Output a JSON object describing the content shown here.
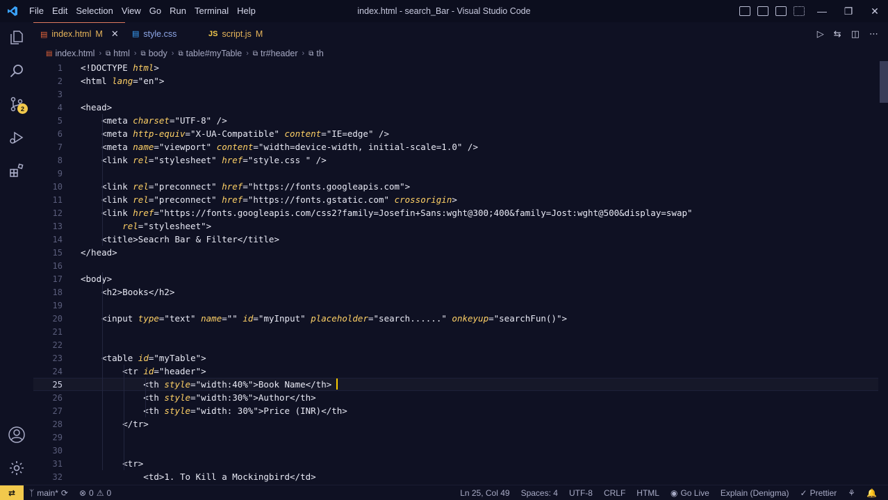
{
  "window": {
    "title": "index.html - search_Bar - Visual Studio Code",
    "menu": [
      "File",
      "Edit",
      "Selection",
      "View",
      "Go",
      "Run",
      "Terminal",
      "Help"
    ]
  },
  "activity_bar": {
    "scm_badge": "2",
    "items": [
      "explorer-icon",
      "search-icon",
      "source-control-icon",
      "run-debug-icon",
      "extensions-icon",
      "accounts-icon",
      "settings-gear-icon"
    ]
  },
  "tabs": [
    {
      "label": "index.html",
      "status": "M",
      "icon": "html-file-icon",
      "active": true
    },
    {
      "label": "style.css",
      "status": "",
      "icon": "css-file-icon",
      "active": false
    },
    {
      "label": "script.js",
      "status": "M",
      "icon": "js-file-icon",
      "active": false
    }
  ],
  "tab_icons": {
    "js": "JS"
  },
  "breadcrumbs": [
    "index.html",
    "html",
    "body",
    "table#myTable",
    "tr#header",
    "th"
  ],
  "editor": {
    "current_line": 25,
    "lines": [
      {
        "n": "1",
        "text": "<!DOCTYPE html>"
      },
      {
        "n": "2",
        "text": "<html lang=\"en\">"
      },
      {
        "n": "3",
        "text": ""
      },
      {
        "n": "4",
        "text": "<head>"
      },
      {
        "n": "5",
        "text": "    <meta charset=\"UTF-8\" />"
      },
      {
        "n": "6",
        "text": "    <meta http-equiv=\"X-UA-Compatible\" content=\"IE=edge\" />"
      },
      {
        "n": "7",
        "text": "    <meta name=\"viewport\" content=\"width=device-width, initial-scale=1.0\" />"
      },
      {
        "n": "8",
        "text": "    <link rel=\"stylesheet\" href=\"style.css \" />"
      },
      {
        "n": "9",
        "text": ""
      },
      {
        "n": "10",
        "text": "    <link rel=\"preconnect\" href=\"https://fonts.googleapis.com\">"
      },
      {
        "n": "11",
        "text": "    <link rel=\"preconnect\" href=\"https://fonts.gstatic.com\" crossorigin>"
      },
      {
        "n": "12",
        "text": "    <link href=\"https://fonts.googleapis.com/css2?family=Josefin+Sans:wght@300;400&family=Jost:wght@500&display=swap\""
      },
      {
        "n": "13",
        "text": "        rel=\"stylesheet\">"
      },
      {
        "n": "14",
        "text": "    <title>Seacrh Bar & Filter</title>"
      },
      {
        "n": "15",
        "text": "</head>"
      },
      {
        "n": "16",
        "text": ""
      },
      {
        "n": "17",
        "text": "<body>"
      },
      {
        "n": "18",
        "text": "    <h2>Books</h2>"
      },
      {
        "n": "19",
        "text": ""
      },
      {
        "n": "20",
        "text": "    <input type=\"text\" name=\"\" id=\"myInput\" placeholder=\"search......\" onkeyup=\"searchFun()\">"
      },
      {
        "n": "21",
        "text": ""
      },
      {
        "n": "22",
        "text": ""
      },
      {
        "n": "23",
        "text": "    <table id=\"myTable\">"
      },
      {
        "n": "24",
        "text": "        <tr id=\"header\">"
      },
      {
        "n": "25",
        "text": "            <th style=\"width:40%\">Book Name</th>"
      },
      {
        "n": "26",
        "text": "            <th style=\"width:30%\">Author</th>"
      },
      {
        "n": "27",
        "text": "            <th style=\"width: 30%\">Price (INR)</th>"
      },
      {
        "n": "28",
        "text": "        </tr>"
      },
      {
        "n": "29",
        "text": ""
      },
      {
        "n": "30",
        "text": ""
      },
      {
        "n": "31",
        "text": "        <tr>"
      },
      {
        "n": "32",
        "text": "            <td>1. To Kill a Mockingbird</td>"
      }
    ]
  },
  "status_bar": {
    "branch": "main*",
    "errors": "0",
    "warnings": "0",
    "position": "Ln 25, Col 49",
    "spaces": "Spaces: 4",
    "encoding": "UTF-8",
    "eol": "CRLF",
    "language": "HTML",
    "go_live": "Go Live",
    "explain": "Explain (Denigma)",
    "prettier": "Prettier"
  },
  "colors": {
    "background": "#0f1123",
    "attribute": "#ffd166",
    "modified": "#e6b45a",
    "badge": "#f2c94c"
  }
}
